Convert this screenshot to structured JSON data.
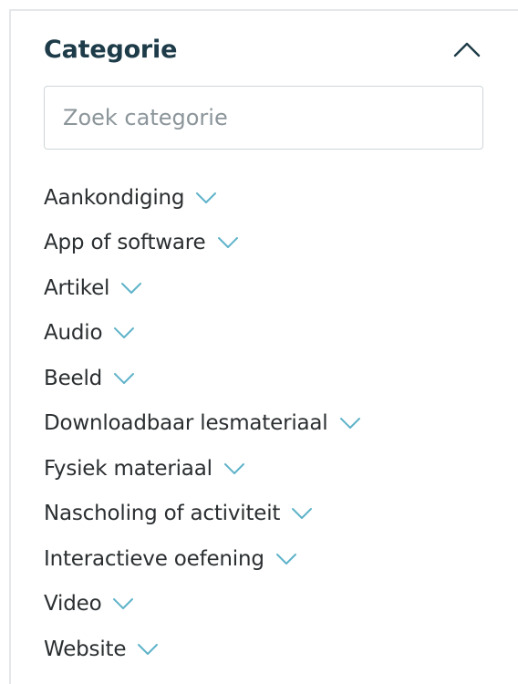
{
  "filter": {
    "title": "Categorie",
    "search": {
      "placeholder": "Zoek categorie",
      "value": ""
    },
    "items": [
      {
        "label": "Aankondiging"
      },
      {
        "label": "App of software"
      },
      {
        "label": "Artikel"
      },
      {
        "label": "Audio"
      },
      {
        "label": "Beeld"
      },
      {
        "label": "Downloadbaar lesmateriaal"
      },
      {
        "label": "Fysiek materiaal"
      },
      {
        "label": "Nascholing of activiteit"
      },
      {
        "label": "Interactieve oefening"
      },
      {
        "label": "Video"
      },
      {
        "label": "Website"
      }
    ],
    "icons": {
      "collapse": "chevron-up-icon",
      "expand": "chevron-down-icon"
    }
  },
  "colors": {
    "title": "#1d3b48",
    "accent": "#5fb3c9",
    "text": "#2b2f31",
    "border": "#cfd6d9"
  }
}
